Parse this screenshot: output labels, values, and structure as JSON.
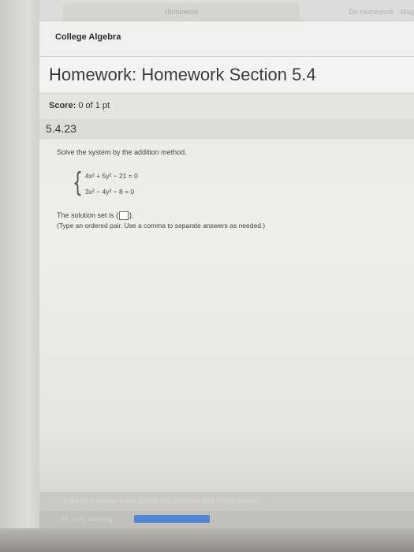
{
  "browser": {
    "tabs": [
      {
        "label": "Homework"
      },
      {
        "label": "Do Homework - Mag"
      }
    ]
  },
  "course": {
    "title": "College Algebra"
  },
  "homework": {
    "title": "Homework: Homework Section 5.4"
  },
  "score": {
    "label": "Score:",
    "value": "0 of 1 pt"
  },
  "question": {
    "number": "5.4.23",
    "prompt": "Solve the system by the addition method.",
    "equations": [
      "4x² + 5y² − 21 = 0",
      "3x² − 4y² − 8 = 0"
    ],
    "answer_prefix": "The solution set is {",
    "answer_value": "",
    "answer_suffix": "}.",
    "hint": "(Type an ordered pair. Use a comma to separate answers as needed.)"
  },
  "footer": {
    "instruction": "Enter your answer in the answer box and then click Check Answer.",
    "parts_label": "All parts showing",
    "progress_fraction": 1.0
  }
}
